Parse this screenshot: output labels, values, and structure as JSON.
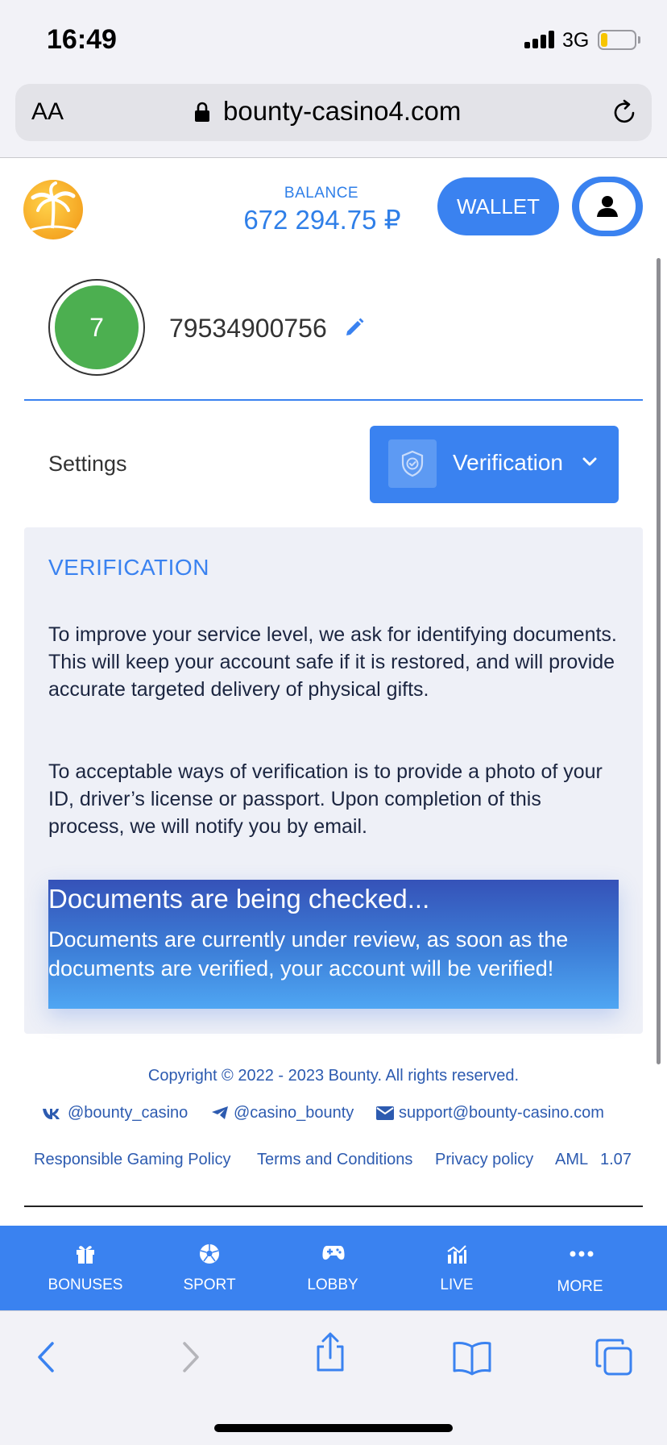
{
  "status_bar": {
    "time": "16:49",
    "network": "3G"
  },
  "browser": {
    "text_size_label": "AA",
    "url": "bounty-casino4.com"
  },
  "header": {
    "balance_label": "BALANCE",
    "balance_value": "672 294.75 ₽",
    "wallet_label": "WALLET"
  },
  "profile": {
    "avatar_initial": "7",
    "user_id": "79534900756"
  },
  "tabs": {
    "settings_label": "Settings",
    "dropdown_label": "Verification"
  },
  "verification": {
    "title": "VERIFICATION",
    "paragraph_1": "To improve your service level, we ask for identifying documents. This will keep your account safe if it is restored, and will provide accurate targeted delivery of physical gifts.",
    "paragraph_2": "To acceptable ways of verification is to provide a photo of your ID, driver’s license or passport. Upon completion of this process, we will notify you by email.",
    "status_title": "Documents are being checked...",
    "status_text": "Documents are currently under review, as soon as the documents are verified, your account will be verified!"
  },
  "footer": {
    "copyright": "Copyright © 2022 - 2023 Bounty. All rights reserved.",
    "socials": [
      {
        "icon": "vk-icon",
        "text": "@bounty_casino"
      },
      {
        "icon": "telegram-icon",
        "text": "@casino_bounty"
      },
      {
        "icon": "mail-icon",
        "text": "support@bounty-casino.com"
      }
    ],
    "links": [
      "Responsible Gaming Policy",
      "Terms and Conditions",
      "Privacy policy",
      "AML",
      "1.07"
    ]
  },
  "bottom_nav": [
    {
      "icon": "gift-icon",
      "label": "BONUSES"
    },
    {
      "icon": "soccer-ball-icon",
      "label": "SPORT"
    },
    {
      "icon": "gamepad-icon",
      "label": "LOBBY"
    },
    {
      "icon": "live-chart-icon",
      "label": "LIVE"
    },
    {
      "icon": "more-dots-icon",
      "label": "MORE"
    }
  ],
  "colors": {
    "accent": "#3a82f0",
    "link": "#2d5bb0",
    "avatar": "#4caf50",
    "panel": "#eef0f7"
  }
}
